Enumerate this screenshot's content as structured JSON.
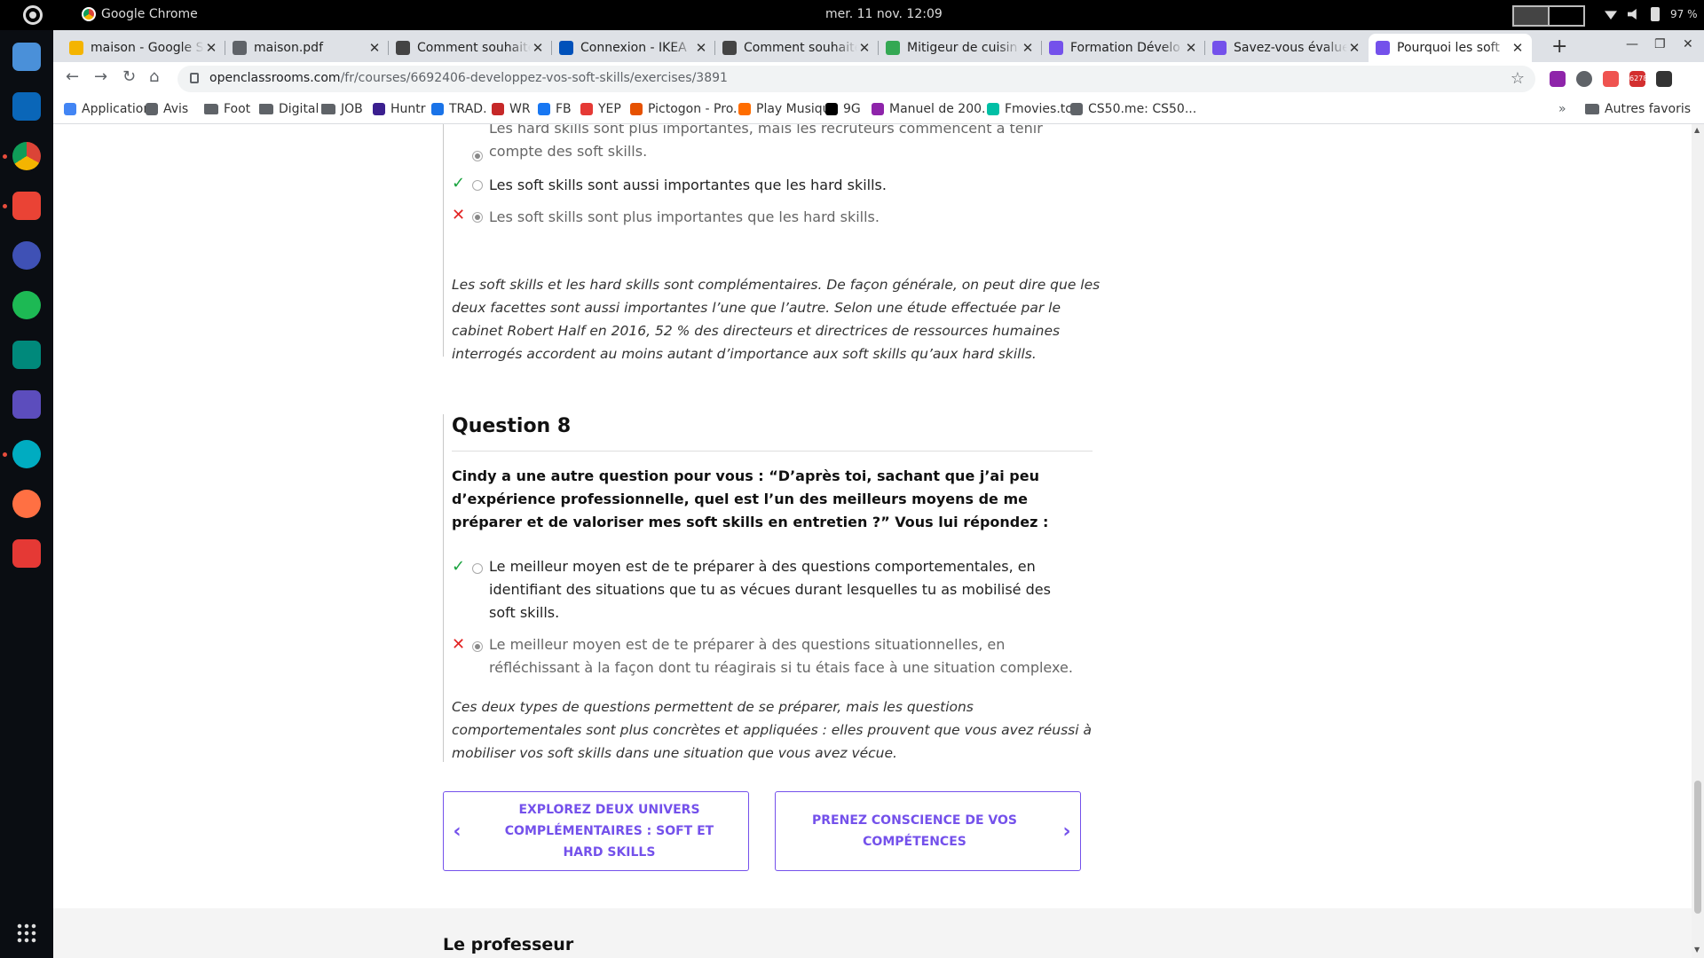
{
  "os": {
    "app_name": "Google Chrome",
    "clock": "mer. 11 nov.  12:09",
    "battery": "97 %"
  },
  "tabs": [
    {
      "title": "maison - Google S",
      "color": "#f4b400"
    },
    {
      "title": "maison.pdf",
      "color": "#5f6368"
    },
    {
      "title": "Comment souhaite",
      "color": "#444444"
    },
    {
      "title": "Connexion - IKEA",
      "color": "#0051ba"
    },
    {
      "title": "Comment souhaite",
      "color": "#444444"
    },
    {
      "title": "Mitigeur de cuisin",
      "color": "#34a853"
    },
    {
      "title": "Formation Dévelo",
      "color": "#7451eb"
    },
    {
      "title": "Savez-vous évalue",
      "color": "#7451eb"
    },
    {
      "title": "Pourquoi les soft",
      "color": "#7451eb"
    }
  ],
  "address": {
    "domain": "openclassrooms.com",
    "path": "/fr/courses/6692406-developpez-vos-soft-skills/exercises/3891",
    "badge": "6278"
  },
  "bookmarks": [
    {
      "label": "Applications",
      "icon": "apps-grid-icon",
      "color": "#4285f4"
    },
    {
      "label": "Avis",
      "icon": "globe-icon",
      "color": "#5f6368"
    },
    {
      "label": "Foot",
      "icon": "folder-icon",
      "color": "#5f6368"
    },
    {
      "label": "Digital",
      "icon": "folder-icon",
      "color": "#5f6368"
    },
    {
      "label": "JOB",
      "icon": "folder-icon",
      "color": "#5f6368"
    },
    {
      "label": "Huntr",
      "icon": "huntr-icon",
      "color": "#3b1f8f"
    },
    {
      "label": "TRAD.",
      "icon": "trad-icon",
      "color": "#1a73e8"
    },
    {
      "label": "WR",
      "icon": "wr-icon",
      "color": "#c62828"
    },
    {
      "label": "FB",
      "icon": "facebook-icon",
      "color": "#1877f2"
    },
    {
      "label": "YEP",
      "icon": "yep-icon",
      "color": "#e53935"
    },
    {
      "label": "Pictogon - Pro...",
      "icon": "pictogon-icon",
      "color": "#e65100"
    },
    {
      "label": "Play Musique",
      "icon": "play-music-icon",
      "color": "#ff6d00"
    },
    {
      "label": "9G",
      "icon": "ninegag-icon",
      "color": "#000000"
    },
    {
      "label": "Manuel de 200...",
      "icon": "manuel-icon",
      "color": "#8e24aa"
    },
    {
      "label": "Fmovies.to",
      "icon": "fmovies-icon",
      "color": "#00bfa5"
    },
    {
      "label": "CS50.me: CS50...",
      "icon": "globe-icon",
      "color": "#5f6368"
    }
  ],
  "bookmarks_other": "Autres favoris",
  "q7": {
    "partial_option": "Les hard skills sont plus importantes, mais les recruteurs commencent à tenir compte des soft skills.",
    "correct_option": "Les soft skills sont aussi importantes que les hard skills.",
    "wrong_option": "Les soft skills sont plus importantes que les hard skills.",
    "explanation": "Les soft skills et les hard skills sont complémentaires. De façon générale, on peut dire que les deux facettes sont aussi importantes l’une que l’autre. Selon une étude effectuée par le cabinet Robert Half en 2016, 52 % des directeurs et directrices de ressources humaines interrogés accordent au moins autant d’importance aux soft skills qu’aux hard skills."
  },
  "q8": {
    "title": "Question 8",
    "question": "Cindy a une autre question pour vous : “D’après toi, sachant que j’ai peu d’expérience professionnelle, quel est l’un des meilleurs moyens de me préparer et de valoriser mes soft skills en entretien ?” Vous lui répondez :",
    "correct_option": "Le meilleur moyen est de te préparer à des questions comportementales, en identifiant des situations que tu as vécues durant lesquelles tu as mobilisé des soft skills.",
    "wrong_option": "Le meilleur moyen est de te préparer à des questions situationnelles, en réfléchissant à la façon dont tu réagirais si tu étais face à une situation complexe.",
    "explanation": "Ces deux types de questions permettent de se préparer, mais les questions comportementales sont plus concrètes et appliquées : elles prouvent que vous avez réussi à mobiliser vos soft skills dans une situation que vous avez vécue."
  },
  "nav": {
    "prev": "EXPLOREZ DEUX UNIVERS COMPLÉMENTAIRES : SOFT ET HARD SKILLS",
    "next": "PRENEZ CONSCIENCE DE VOS COMPÉTENCES"
  },
  "footer_heading": "Le professeur",
  "colors": {
    "accent": "#7451eb",
    "correct": "#1aa33f",
    "wrong": "#e22222"
  }
}
